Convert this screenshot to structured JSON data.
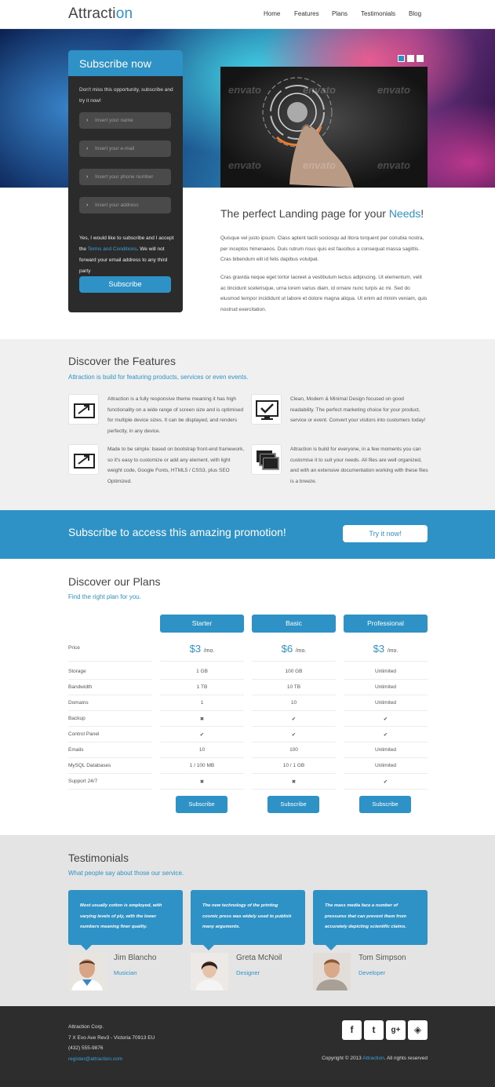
{
  "brand": {
    "logo_main": "Attracti",
    "logo_accent": "on",
    "accent_color": "#2f92c6"
  },
  "nav": {
    "items": [
      "Home",
      "Features",
      "Plans",
      "Testimonials",
      "Blog"
    ]
  },
  "hero": {
    "watermark": "envato"
  },
  "subscribe_card": {
    "title": "Subscribe now",
    "intro": "Don't miss this opportunity, subscribe and try it now!",
    "placeholders": {
      "name": "Insert your name",
      "email": "Insert your e-mail",
      "phone": "Insert your phone number",
      "address": "Insert your address"
    },
    "agree_before": "Yes, I would like to subscribe and I accept the ",
    "agree_link": "Terms and Conditions",
    "agree_after": ". We will not forward your email address to any third party",
    "button": "Subscribe"
  },
  "intro": {
    "title_before": "The perfect Landing page for your ",
    "title_accent": "Needs",
    "title_after": "!",
    "para1": "Quisque vel justo ipsum. Class aptent taciti sociosqu ad litora torquent per conubia nostra, per inceptos himenaeos. Duis rutrum risus quis est faucibus a consequat massa sagittis. Cras bibendum elit id felis dapibus volutpat.",
    "para2": "Cras gravida neque eget tortor laoreet a vestibulum lectus adipiscing. Ut elementum, velit ac tincidunt scelerisque, urna lorem varius diam, id ornare nunc turpis ac mi. Sed do eiusmod tempor incididunt ut labore et dolore magna aliqua. Ut enim ad minim veniam, quis nostrud exercitation."
  },
  "features": {
    "title": "Discover the Features",
    "subtitle": "Attraction is build for featuring products, services or even events.",
    "items": [
      {
        "icon": "expand-icon",
        "text": "Attraction is a fully responsive theme meaning it has high functionality on a wide range of screen size and is optimised for multiple device sizes. It can be displayed, and renders perfectly, in any device."
      },
      {
        "icon": "monitor-check-icon",
        "text": "Clean, Modern & Minimal Design focused on good readability. The perfect marketing choice for your product, service or event. Convert your visitors into customers today!"
      },
      {
        "icon": "expand-icon",
        "text": "Made to be simple: based on bootstrap front-end framework, so it's easy to customize or add any element, with light weight code, Google Fonts, HTML5 / CSS3, plus SEO Optimized."
      },
      {
        "icon": "stacked-windows-icon",
        "text": "Attraction is build for everyone, in a few moments you can customise it to suit your needs. All files are well organized, and with an extensive documentation working with these files is a breeze."
      }
    ]
  },
  "promo": {
    "text": "Subscribe to access this amazing promotion!",
    "button": "Try it now!"
  },
  "plans": {
    "title": "Discover our Plans",
    "subtitle": "Find the right plan for you.",
    "columns": [
      "Starter",
      "Basic",
      "Professional"
    ],
    "price_label": "Price",
    "prices": [
      "$3",
      "$6",
      "$3"
    ],
    "price_unit": "/mo.",
    "rows": [
      {
        "label": "Storage",
        "values": [
          "1 GB",
          "100 GB",
          "Unlimited"
        ]
      },
      {
        "label": "Bandwidth",
        "values": [
          "1 TB",
          "10 TB",
          "Unlimited"
        ]
      },
      {
        "label": "Domains",
        "values": [
          "1",
          "10",
          "Unlimited"
        ]
      },
      {
        "label": "Backup",
        "values": [
          "✖",
          "✔",
          "✔"
        ]
      },
      {
        "label": "Control Panel",
        "values": [
          "✔",
          "✔",
          "✔"
        ]
      },
      {
        "label": "Emails",
        "values": [
          "10",
          "100",
          "Unlimited"
        ]
      },
      {
        "label": "MySQL Databases",
        "values": [
          "1 / 100 MB",
          "10 / 1 GB",
          "Unlimited"
        ]
      },
      {
        "label": "Support 24/7",
        "values": [
          "✖",
          "✖",
          "✔"
        ]
      }
    ],
    "button": "Subscribe"
  },
  "testimonials": {
    "title": "Testimonials",
    "subtitle": "What people say about those our service.",
    "items": [
      {
        "quote": "Most usually cotton is employed, with varying levels of ply, with the lower numbers meaning finer quality.",
        "name": "Jim Blancho",
        "role": "Musician"
      },
      {
        "quote": "The new technology of the printing cosmic press was widely used to publish many arguments.",
        "name": "Greta McNoil",
        "role": "Designer"
      },
      {
        "quote": "The mass media face a number of pressures that can prevent them from accurately depicting scientific claims.",
        "name": "Tom Simpson",
        "role": "Developer"
      }
    ]
  },
  "footer": {
    "company": "Attraction Corp.",
    "address": "7 X Evo Ave Rev3 - Victoria 70913 EU",
    "phone": "(432) 555-9876",
    "email": "register@attraction.com",
    "social": [
      "f",
      "t",
      "g+",
      "◈"
    ],
    "copyright_before": "Copyright © 2013 ",
    "copyright_link": "Attraction",
    "copyright_after": ". All rights reserved"
  }
}
